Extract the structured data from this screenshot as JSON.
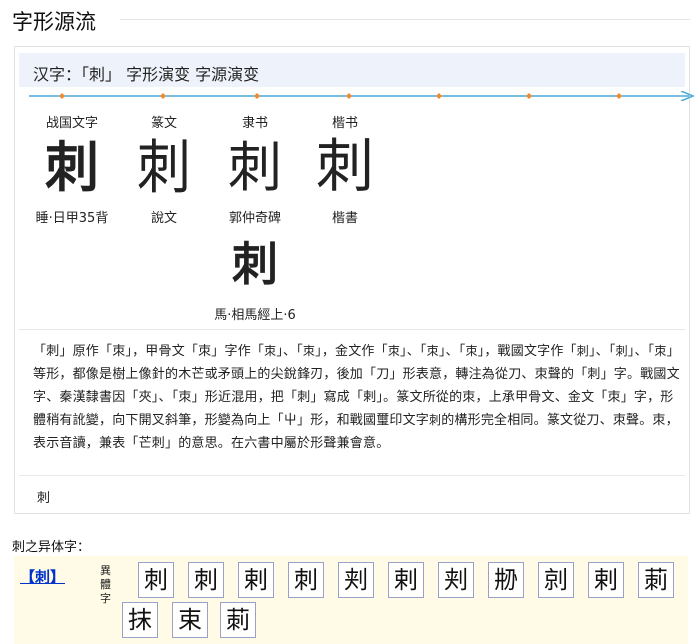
{
  "section_title": "字形源流",
  "panel": {
    "header": "汉字：「刺」 字形演变 字源演变",
    "stages": [
      "战国文字",
      "篆文",
      "隶书",
      "楷书"
    ],
    "row1": [
      {
        "glyph": "刺",
        "source": "睡·日甲35背"
      },
      {
        "glyph": "刺",
        "source": "說文"
      },
      {
        "glyph": "刺",
        "source": "郭仲奇碑"
      },
      {
        "glyph": "刺",
        "source": "楷書"
      }
    ],
    "row2": [
      {
        "glyph": "刺",
        "source": "馬·相馬經上·6"
      }
    ],
    "paragraph": {
      "p1": "「刺」原作「朿」，甲骨文「朿」字作「",
      "g1": "朿",
      "p2": "」、「",
      "g2": "朿",
      "p3": "」，金文作「",
      "g3": "朿",
      "p4": "」、「",
      "g4": "朿",
      "p5": "」、「",
      "g5": "朿",
      "p6": "」，戰國文字作「",
      "g6": "刺",
      "p7": "」、「",
      "g7": "刺",
      "p8": "」、「",
      "g8": "朿",
      "p9": "」等形，都像是樹上像針的木芒或矛頭上的尖銳鋒刃，後加「刀」形表意，轉注為從刀、朿聲的「刺」字。戰國文字、秦漢隸書因「夾」、「朿」形近混用，把「刺」寫成「剌」。篆文所從的朿，上承甲骨文、金文「朿」字，形體稍有訛變，向下開叉斜筆，形變為向上「屮」形，和戰國璽印文字",
      "g9": "刺",
      "p10": "的構形完全相同。篆文從刀、朿聲。朿，表示音讀，兼表「芒刺」的意思。在六書中屬於形聲兼會意。"
    },
    "footer_char": "刺"
  },
  "variants": {
    "title": "刺之异体字：",
    "link": "【刺】",
    "tag": "異體字",
    "chars": [
      "刺",
      "刺",
      "剌",
      "刺",
      "刾",
      "剌",
      "刾",
      "刱",
      "剠",
      "剌",
      "莿",
      "抹",
      "束",
      "莿"
    ]
  }
}
